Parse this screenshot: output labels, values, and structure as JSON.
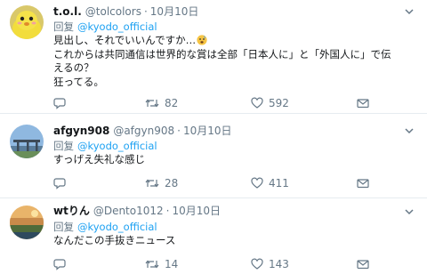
{
  "colors": {
    "text": "#14171a",
    "muted": "#657786",
    "link": "#1da1f2",
    "divider": "#e6ecf0"
  },
  "tweets": [
    {
      "name": "t.o.l.",
      "handle": "@tolcolors",
      "separator": "·",
      "date": "10月10日",
      "reply_prefix": "回复",
      "reply_to": "@kyodo_official",
      "body_lines": [
        "見出し、それでいいんですか…",
        "これからは共同通信は世界的な賞は全部「日本人に」と「外国人に」で伝",
        "えるの？",
        "狂ってる。"
      ],
      "emoji": "anxious-face-emoji",
      "retweets": "82",
      "likes": "592",
      "avatar": "yellow-bird-avatar"
    },
    {
      "name": "afgyn908",
      "handle": "@afgyn908",
      "separator": "·",
      "date": "10月10日",
      "reply_prefix": "回复",
      "reply_to": "@kyodo_official",
      "body_lines": [
        "すっげえ失礼な感じ"
      ],
      "retweets": "28",
      "likes": "411",
      "avatar": "bridge-avatar"
    },
    {
      "name": "wtりん",
      "handle": "@Dento1012",
      "separator": "·",
      "date": "10月10日",
      "reply_prefix": "回复",
      "reply_to": "@kyodo_official",
      "body_lines": [
        "なんだこの手抜きニュース"
      ],
      "retweets": "14",
      "likes": "143",
      "avatar": "landscape-avatar"
    }
  ],
  "icons": {
    "reply": "reply-icon",
    "retweet": "retweet-icon",
    "like": "heart-icon",
    "message": "message-icon",
    "more": "chevron-down-icon"
  }
}
